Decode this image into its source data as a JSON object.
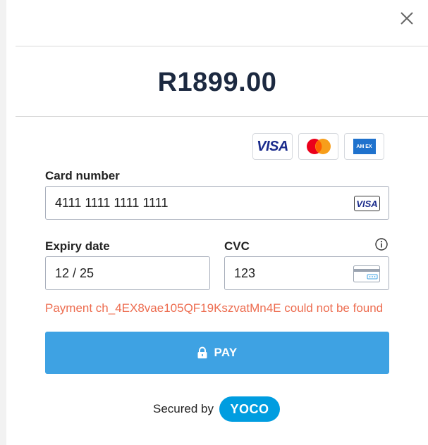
{
  "payment": {
    "amount": "R1899.00"
  },
  "brands": {
    "visa": "VISA",
    "amex": "AM EX"
  },
  "card_number": {
    "label": "Card number",
    "value": "4111 1111 1111 1111",
    "brand_badge": "VISA"
  },
  "expiry": {
    "label": "Expiry date",
    "value": "12 / 25"
  },
  "cvc": {
    "label": "CVC",
    "value": "123"
  },
  "error_message": "Payment ch_4EX8vae105QF19KszvatMn4E could not be found",
  "pay_button": {
    "label": "PAY"
  },
  "footer": {
    "secured_by": "Secured by",
    "provider": "YOCO"
  },
  "colors": {
    "amount": "#1c2940",
    "pay_button": "#3ea2e3",
    "error": "#ed6c4f",
    "yoco": "#009de0",
    "mastercard_red": "#eb001b",
    "mastercard_orange": "#f79e1b"
  },
  "icons": [
    "close-icon",
    "visa-logo-icon",
    "mastercard-logo-icon",
    "amex-logo-icon",
    "info-icon",
    "cvc-card-icon",
    "lock-icon",
    "yoco-logo-icon"
  ]
}
